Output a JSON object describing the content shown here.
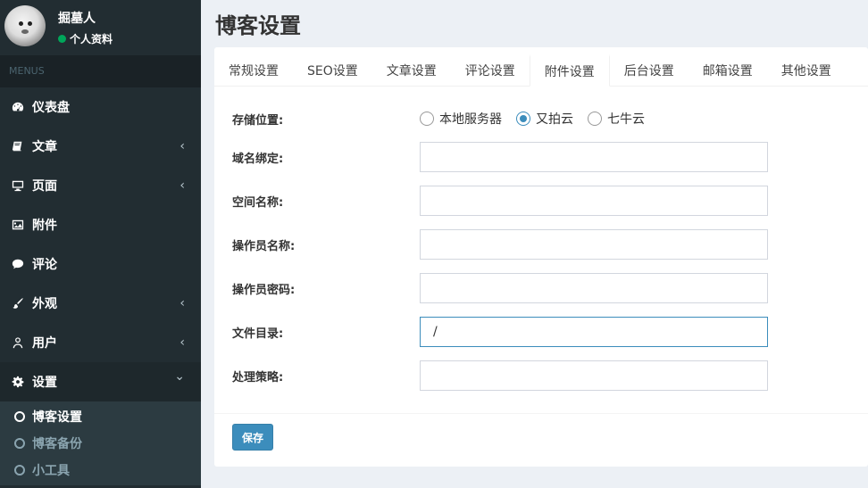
{
  "user": {
    "name": "掘墓人",
    "status": "个人资料"
  },
  "menu_header": "MENUS",
  "nav": [
    {
      "label": "仪表盘",
      "icon": "dashboard-icon",
      "chevron": ""
    },
    {
      "label": "文章",
      "icon": "book-icon",
      "chevron": "‹"
    },
    {
      "label": "页面",
      "icon": "monitor-icon",
      "chevron": "‹"
    },
    {
      "label": "附件",
      "icon": "image-icon",
      "chevron": ""
    },
    {
      "label": "评论",
      "icon": "comment-icon",
      "chevron": ""
    },
    {
      "label": "外观",
      "icon": "brush-icon",
      "chevron": "‹"
    },
    {
      "label": "用户",
      "icon": "user-icon",
      "chevron": "‹"
    },
    {
      "label": "设置",
      "icon": "gear-icon",
      "chevron": "⌄"
    }
  ],
  "settings_sub": [
    "博客设置",
    "博客备份",
    "小工具"
  ],
  "page_title": "博客设置",
  "tabs": [
    "常规设置",
    "SEO设置",
    "文章设置",
    "评论设置",
    "附件设置",
    "后台设置",
    "邮箱设置",
    "其他设置"
  ],
  "active_tab": "附件设置",
  "form": {
    "storage_label": "存储位置:",
    "storage_options": [
      "本地服务器",
      "又拍云",
      "七牛云"
    ],
    "storage_selected": "又拍云",
    "domain_label": "域名绑定:",
    "domain_value": "",
    "space_label": "空间名称:",
    "space_value": "",
    "operator_label": "操作员名称:",
    "operator_value": "",
    "password_label": "操作员密码:",
    "password_value": "",
    "dir_label": "文件目录:",
    "dir_value": "/",
    "policy_label": "处理策略:",
    "policy_value": ""
  },
  "save_label": "保存",
  "colors": {
    "accent": "#3c8dbc",
    "sidebar": "#222d32",
    "online": "#00a65a"
  }
}
